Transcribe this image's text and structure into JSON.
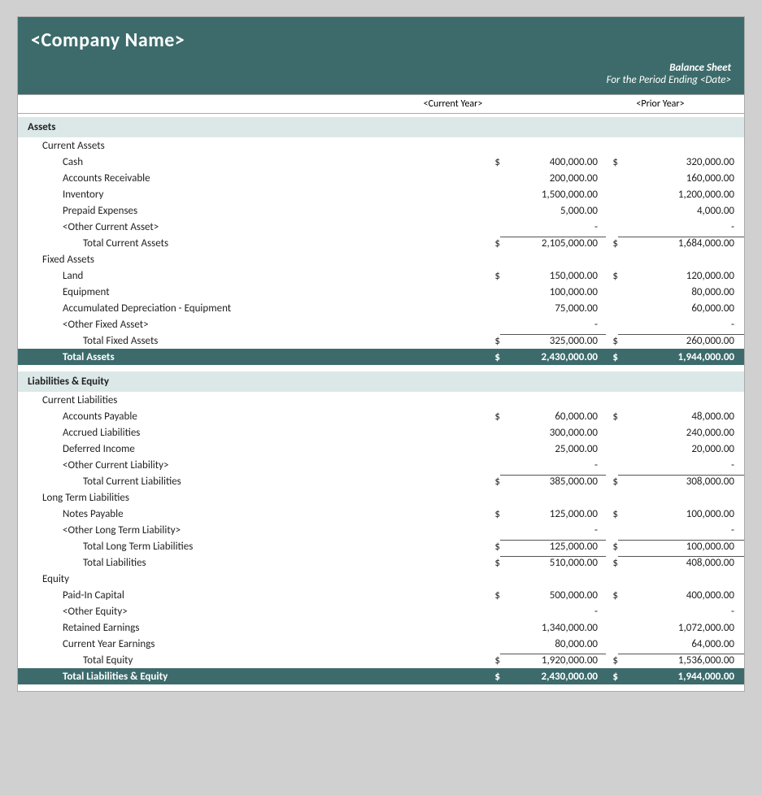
{
  "header": {
    "company_name": "<Company Name>",
    "title": "Balance Sheet",
    "period": "For the Period Ending <Date>",
    "col_cy": "<Current Year>",
    "col_py": "<Prior Year>"
  },
  "sections": {
    "assets": {
      "label": "Assets",
      "current_assets": {
        "label": "Current Assets",
        "items": [
          {
            "name": "Cash",
            "dollar": "$",
            "cy": "400,000.00",
            "py_dollar": "$",
            "py": "320,000.00"
          },
          {
            "name": "Accounts Receivable",
            "dollar": "",
            "cy": "200,000.00",
            "py_dollar": "",
            "py": "160,000.00"
          },
          {
            "name": "Inventory",
            "dollar": "",
            "cy": "1,500,000.00",
            "py_dollar": "",
            "py": "1,200,000.00"
          },
          {
            "name": "Prepaid Expenses",
            "dollar": "",
            "cy": "5,000.00",
            "py_dollar": "",
            "py": "4,000.00"
          },
          {
            "name": "<Other Current Asset>",
            "dollar": "",
            "cy": "-",
            "py_dollar": "",
            "py": "-"
          }
        ],
        "total": {
          "name": "Total Current Assets",
          "dollar": "$",
          "cy": "2,105,000.00",
          "py_dollar": "$",
          "py": "1,684,000.00"
        }
      },
      "fixed_assets": {
        "label": "Fixed Assets",
        "items": [
          {
            "name": "Land",
            "dollar": "$",
            "cy": "150,000.00",
            "py_dollar": "$",
            "py": "120,000.00"
          },
          {
            "name": "Equipment",
            "dollar": "",
            "cy": "100,000.00",
            "py_dollar": "",
            "py": "80,000.00"
          },
          {
            "name": "Accumulated Depreciation - Equipment",
            "dollar": "",
            "cy": "75,000.00",
            "py_dollar": "",
            "py": "60,000.00"
          },
          {
            "name": "<Other Fixed Asset>",
            "dollar": "",
            "cy": "-",
            "py_dollar": "",
            "py": "-"
          }
        ],
        "total": {
          "name": "Total Fixed Assets",
          "dollar": "$",
          "cy": "325,000.00",
          "py_dollar": "$",
          "py": "260,000.00"
        }
      },
      "total": {
        "name": "Total Assets",
        "dollar": "$",
        "cy": "2,430,000.00",
        "py_dollar": "$",
        "py": "1,944,000.00"
      }
    },
    "liabilities_equity": {
      "label": "Liabilities & Equity",
      "current_liabilities": {
        "label": "Current Liabilities",
        "items": [
          {
            "name": "Accounts Payable",
            "dollar": "$",
            "cy": "60,000.00",
            "py_dollar": "$",
            "py": "48,000.00"
          },
          {
            "name": "Accrued Liabilities",
            "dollar": "",
            "cy": "300,000.00",
            "py_dollar": "",
            "py": "240,000.00"
          },
          {
            "name": "Deferred Income",
            "dollar": "",
            "cy": "25,000.00",
            "py_dollar": "",
            "py": "20,000.00"
          },
          {
            "name": "<Other Current Liability>",
            "dollar": "",
            "cy": "-",
            "py_dollar": "",
            "py": "-"
          }
        ],
        "total": {
          "name": "Total Current Liabilities",
          "dollar": "$",
          "cy": "385,000.00",
          "py_dollar": "$",
          "py": "308,000.00"
        }
      },
      "long_term_liabilities": {
        "label": "Long Term Liabilities",
        "items": [
          {
            "name": "Notes Payable",
            "dollar": "$",
            "cy": "125,000.00",
            "py_dollar": "$",
            "py": "100,000.00"
          },
          {
            "name": "<Other Long Term Liability>",
            "dollar": "",
            "cy": "-",
            "py_dollar": "",
            "py": "-"
          }
        ],
        "total": {
          "name": "Total Long Term Liabilities",
          "dollar": "$",
          "cy": "125,000.00",
          "py_dollar": "$",
          "py": "100,000.00"
        }
      },
      "total_liabilities": {
        "name": "Total Liabilities",
        "dollar": "$",
        "cy": "510,000.00",
        "py_dollar": "$",
        "py": "408,000.00"
      },
      "equity": {
        "label": "Equity",
        "items": [
          {
            "name": "Paid-In Capital",
            "dollar": "$",
            "cy": "500,000.00",
            "py_dollar": "$",
            "py": "400,000.00"
          },
          {
            "name": "<Other Equity>",
            "dollar": "",
            "cy": "-",
            "py_dollar": "",
            "py": "-"
          },
          {
            "name": "Retained Earnings",
            "dollar": "",
            "cy": "1,340,000.00",
            "py_dollar": "",
            "py": "1,072,000.00"
          },
          {
            "name": "Current Year Earnings",
            "dollar": "",
            "cy": "80,000.00",
            "py_dollar": "",
            "py": "64,000.00"
          }
        ],
        "total": {
          "name": "Total Equity",
          "dollar": "$",
          "cy": "1,920,000.00",
          "py_dollar": "$",
          "py": "1,536,000.00"
        }
      },
      "total": {
        "name": "Total Liabilities & Equity",
        "dollar": "$",
        "cy": "2,430,000.00",
        "py_dollar": "$",
        "py": "1,944,000.00"
      }
    }
  }
}
